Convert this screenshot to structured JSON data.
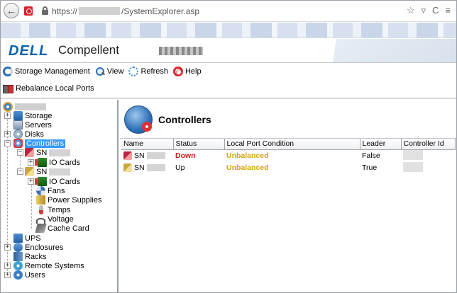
{
  "browser": {
    "url_prefix": "https://",
    "url_path": "/SystemExplorer.asp",
    "back_icon": "back-arrow-icon",
    "star_icon": "☆",
    "dropdown_icon": "▿",
    "reload_icon": "C",
    "menu_icon": "≡"
  },
  "header": {
    "brand": "DELL",
    "product": "Compellent",
    "brand_color": "#0a62a9"
  },
  "toolbar": {
    "storage_management": "Storage Management",
    "view": "View",
    "refresh": "Refresh",
    "help": "Help",
    "rebalance": "Rebalance Local Ports"
  },
  "tree": {
    "items": {
      "storage": "Storage",
      "servers": "Servers",
      "disks": "Disks",
      "controllers": "Controllers",
      "sn1": "SN",
      "sn1_iocards": "IO Cards",
      "sn2": "SN",
      "sn2_iocards": "IO Cards",
      "fans": "Fans",
      "power_supplies": "Power Supplies",
      "temps": "Temps",
      "voltage": "Voltage",
      "cache_card": "Cache Card",
      "ups": "UPS",
      "enclosures": "Enclosures",
      "racks": "Racks",
      "remote_systems": "Remote Systems",
      "users": "Users"
    },
    "expander_plus": "+",
    "expander_minus": "−"
  },
  "content": {
    "title": "Controllers",
    "columns": [
      "Name",
      "Status",
      "Local Port Condition",
      "Leader",
      "Controller Id"
    ],
    "rows": [
      {
        "name": "SN",
        "status": "Down",
        "condition": "Unbalanced",
        "leader": "False"
      },
      {
        "name": "SN",
        "status": "Up",
        "condition": "Unbalanced",
        "leader": "True"
      }
    ],
    "status_down_color": "#cc1b1b",
    "unbalanced_color": "#d4a40e"
  }
}
